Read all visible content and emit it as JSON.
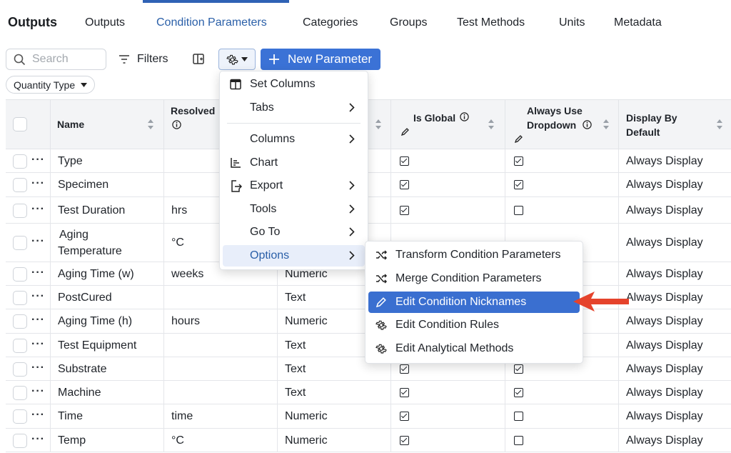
{
  "nav": {
    "brand": "Outputs",
    "tabs": [
      {
        "label": "Outputs"
      },
      {
        "label": "Condition Parameters"
      },
      {
        "label": "Categories"
      },
      {
        "label": "Groups"
      },
      {
        "label": "Test Methods"
      },
      {
        "label": "Units"
      },
      {
        "label": "Metadata"
      }
    ],
    "active_tab": "Condition Parameters"
  },
  "toolbar": {
    "search_placeholder": "Search",
    "filters_label": "Filters",
    "new_button_label": "New Parameter",
    "quantity_chip_label": "Quantity Type"
  },
  "table": {
    "headers": {
      "name": "Name",
      "resolved": "Resolved",
      "is_global": "Is Global",
      "always_use": "Always Use",
      "dropdown": "Dropdown",
      "display_by": "Display By",
      "default": "Default"
    },
    "rows": [
      {
        "name": "Type",
        "unit": "",
        "type": "",
        "global": true,
        "dropdown": true,
        "display": "Always Display"
      },
      {
        "name": "Specimen",
        "unit": "",
        "type": "",
        "global": true,
        "dropdown": true,
        "display": "Always Display"
      },
      {
        "name": "Test Duration",
        "unit": "hrs",
        "type": "",
        "global": true,
        "dropdown": false,
        "display": "Always Display"
      },
      {
        "name": "Aging Temperature",
        "unit": "°C",
        "type": "",
        "global": null,
        "dropdown": null,
        "display": "Always Display"
      },
      {
        "name": "Aging Time (w)",
        "unit": "weeks",
        "type": "Numeric",
        "global": null,
        "dropdown": null,
        "display": "Always Display"
      },
      {
        "name": "PostCured",
        "unit": "",
        "type": "Text",
        "global": null,
        "dropdown": null,
        "display": "Always Display"
      },
      {
        "name": "Aging Time (h)",
        "unit": "hours",
        "type": "Numeric",
        "global": null,
        "dropdown": null,
        "display": "Always Display"
      },
      {
        "name": "Test Equipment",
        "unit": "",
        "type": "Text",
        "global": null,
        "dropdown": null,
        "display": "Always Display"
      },
      {
        "name": "Substrate",
        "unit": "",
        "type": "Text",
        "global": true,
        "dropdown": true,
        "display": "Always Display"
      },
      {
        "name": "Machine",
        "unit": "",
        "type": "Text",
        "global": true,
        "dropdown": true,
        "display": "Always Display"
      },
      {
        "name": "Time",
        "unit": "time",
        "type": "Numeric",
        "global": true,
        "dropdown": false,
        "display": "Always Display"
      },
      {
        "name": "Temp",
        "unit": "°C",
        "type": "Numeric",
        "global": true,
        "dropdown": false,
        "display": "Always Display"
      }
    ]
  },
  "gear_menu": {
    "items": [
      {
        "label": "Set Columns",
        "icon": "table-columns-icon",
        "submenu": false
      },
      {
        "label": "Tabs",
        "icon": "",
        "submenu": true
      },
      {
        "label": "Columns",
        "icon": "",
        "submenu": true
      },
      {
        "label": "Chart",
        "icon": "chart-icon",
        "submenu": false
      },
      {
        "label": "Export",
        "icon": "export-icon",
        "submenu": true
      },
      {
        "label": "Tools",
        "icon": "",
        "submenu": true
      },
      {
        "label": "Go To",
        "icon": "",
        "submenu": true
      },
      {
        "label": "Options",
        "icon": "",
        "submenu": true
      }
    ]
  },
  "options_menu": {
    "items": [
      {
        "label": "Transform Condition Parameters",
        "icon": "shuffle-icon"
      },
      {
        "label": "Merge Condition Parameters",
        "icon": "shuffle-icon"
      },
      {
        "label": "Edit Condition Nicknames",
        "icon": "pencil-icon"
      },
      {
        "label": "Edit Condition Rules",
        "icon": "gear-icon"
      },
      {
        "label": "Edit Analytical Methods",
        "icon": "gear-icon"
      }
    ],
    "selected": "Edit Condition Nicknames"
  },
  "colors": {
    "accent": "#3b72d6",
    "active_tab_text": "#2a5fa8",
    "annotation_arrow": "#e5432c"
  }
}
